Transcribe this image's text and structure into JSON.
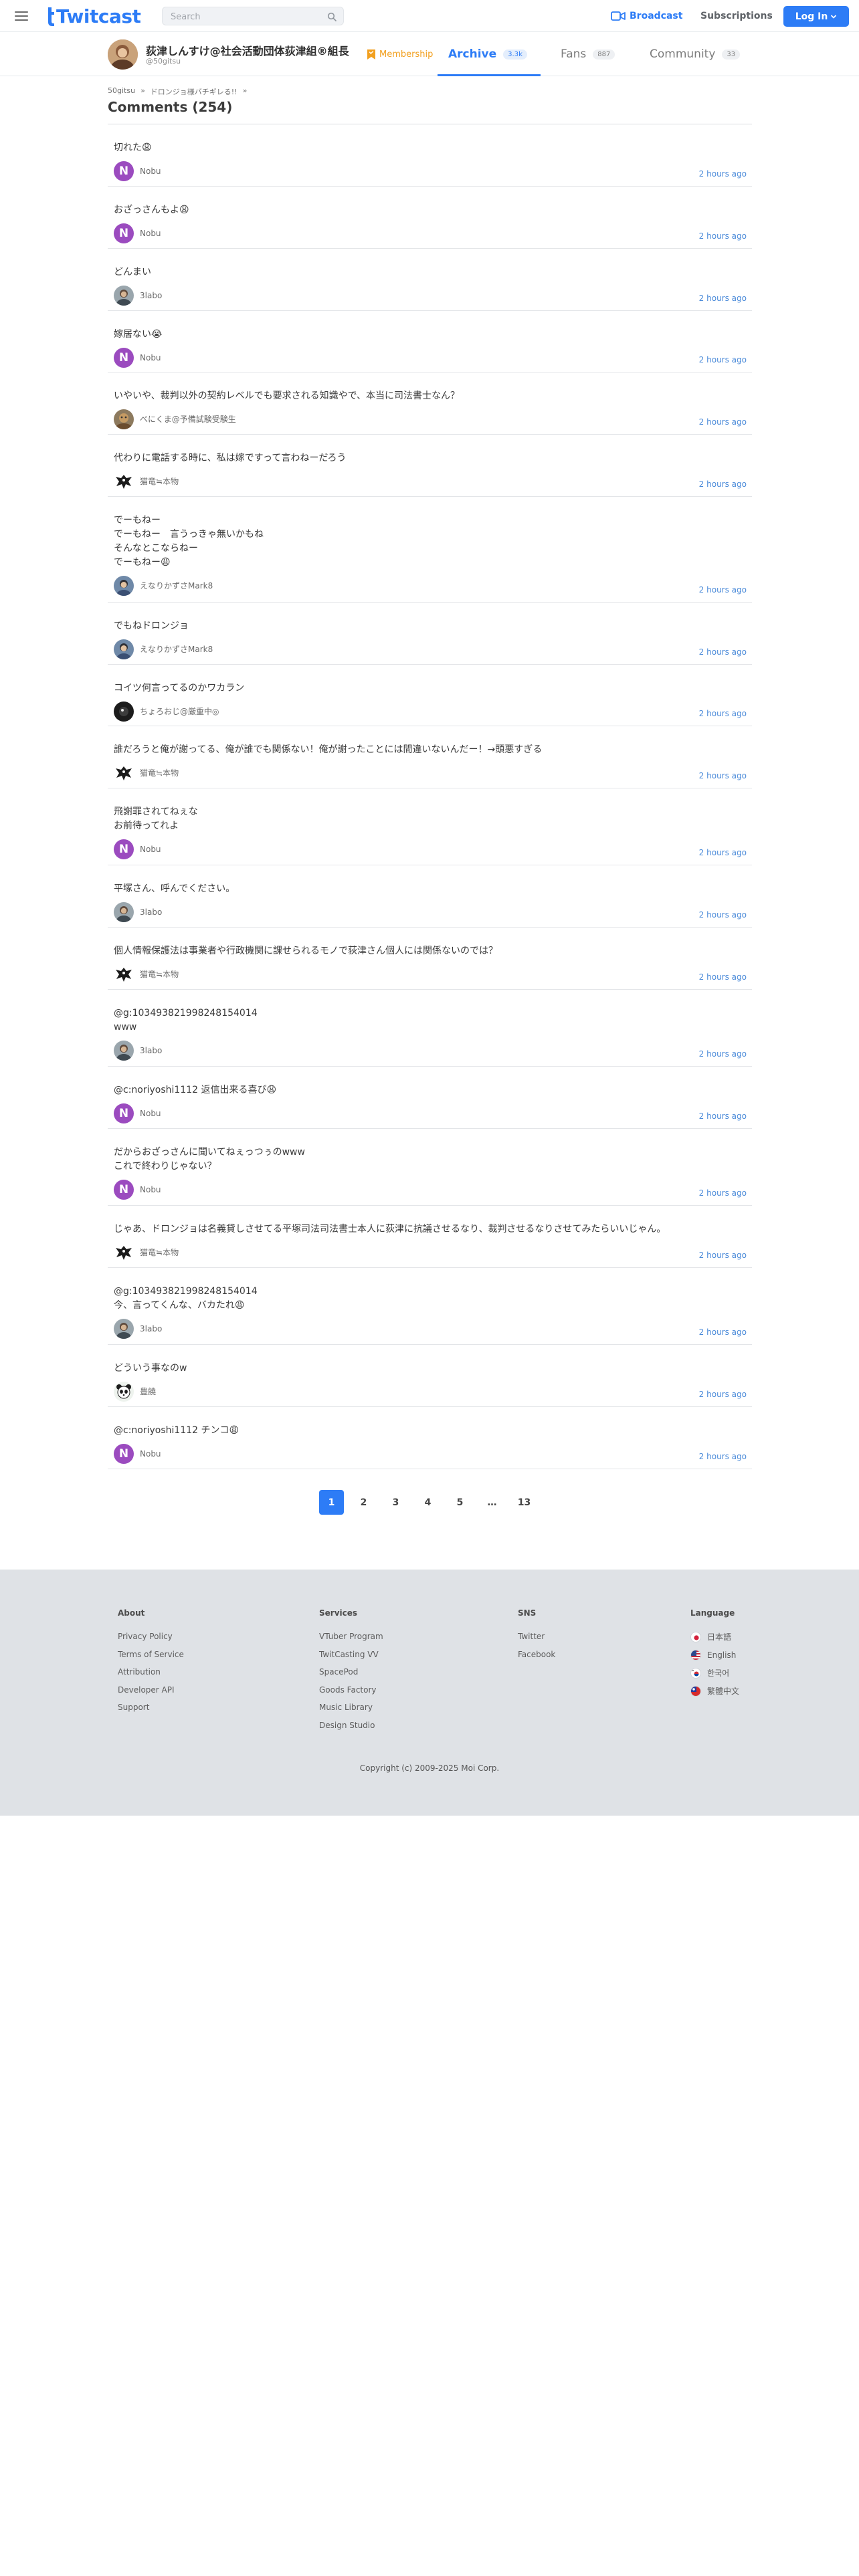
{
  "header": {
    "logo_text": "Twitcast",
    "search_placeholder": "Search",
    "broadcast_label": "Broadcast",
    "subscriptions_label": "Subscriptions",
    "login_label": "Log In"
  },
  "profile": {
    "name": "荻津しんすけ@社会活動団体荻津組®組長",
    "id": "@50gitsu",
    "membership_label": "Membership",
    "tabs": [
      {
        "label": "Archive",
        "count": "3.3k"
      },
      {
        "label": "Fans",
        "count": "887"
      },
      {
        "label": "Community",
        "count": "33"
      }
    ]
  },
  "breadcrumb": [
    "50gitsu",
    "»",
    "ドロンジョ様バチギレる!!",
    "»"
  ],
  "page_title": "Comments (254)",
  "comments": [
    {
      "text": "切れた😩",
      "user": "Nobu",
      "time": "2 hours ago"
    },
    {
      "text": "おざっさんもよ😩",
      "user": "Nobu",
      "time": "2 hours ago"
    },
    {
      "text": "どんまい",
      "user": "3labo",
      "time": "2 hours ago"
    },
    {
      "text": "嫁居ない😭",
      "user": "Nobu",
      "time": "2 hours ago"
    },
    {
      "text": "いやいや、裁判以外の契約レベルでも要求される知識やで、本当に司法書士なん？",
      "user": "べにくま@予備試験受験生",
      "time": "2 hours ago"
    },
    {
      "text": "代わりに電話する時に、私は嫁ですって言わねーだろう",
      "user": "猫竜≒本物",
      "time": "2 hours ago"
    },
    {
      "text": "でーもねー\nでーもねー　言うっきゃ無いかもね\nそんなとこならねー\nでーもねー😩",
      "user": "えなりかずさMark8",
      "time": "2 hours ago"
    },
    {
      "text": "でもねドロンジョ",
      "user": "えなりかずさMark8",
      "time": "2 hours ago"
    },
    {
      "text": "コイツ何言ってるのかワカラン",
      "user": "ちょろおじ@厳重中◎",
      "time": "2 hours ago"
    },
    {
      "text": "誰だろうと俺が謝ってる、俺が誰でも関係ない！俺が謝ったことには間違いないんだー！→頭悪すぎる",
      "user": "猫竜≒本物",
      "time": "2 hours ago"
    },
    {
      "text": "飛謝罪されてねぇな\nお前待ってれよ",
      "user": "Nobu",
      "time": "2 hours ago"
    },
    {
      "text": "平塚さん、呼んでください。",
      "user": "3labo",
      "time": "2 hours ago"
    },
    {
      "text": "個人情報保護法は事業者や行政機関に課せられるモノで荻津さん個人には関係ないのでは？",
      "user": "猫竜≒本物",
      "time": "2 hours ago"
    },
    {
      "text": "@g:103493821998248154014\nwww",
      "user": "3labo",
      "time": "2 hours ago"
    },
    {
      "text": "@c:noriyoshi1112 返信出来る喜び😩",
      "user": "Nobu",
      "time": "2 hours ago"
    },
    {
      "text": "だからおざっさんに聞いてねぇっつぅのwww\nこれで終わりじゃない？",
      "user": "Nobu",
      "time": "2 hours ago"
    },
    {
      "text": "じゃあ、ドロンジョは名義貸しさせてる平塚司法司法書士本人に荻津に抗議させるなり、裁判させるなりさせてみたらいいじゃん。",
      "user": "猫竜≒本物",
      "time": "2 hours ago"
    },
    {
      "text": "@g:103493821998248154014\n今、言ってくんな、バカたれ😩",
      "user": "3labo",
      "time": "2 hours ago"
    },
    {
      "text": "どういう事なのw",
      "user": "豊饒",
      "time": "2 hours ago"
    },
    {
      "text": "@c:noriyoshi1112 チンコ😩",
      "user": "Nobu",
      "time": "2 hours ago"
    }
  ],
  "pagination": [
    "1",
    "2",
    "3",
    "4",
    "5",
    "…",
    "13"
  ],
  "footer": {
    "about": {
      "heading": "About",
      "links": [
        "Privacy Policy",
        "Terms of Service",
        "Attribution",
        "Developer API",
        "Support"
      ]
    },
    "services": {
      "heading": "Services",
      "links": [
        "VTuber Program",
        "TwitCasting VV",
        "SpacePod",
        "Goods Factory",
        "Music Library",
        "Design Studio"
      ]
    },
    "sns": {
      "heading": "SNS",
      "links": [
        "Twitter",
        "Facebook"
      ]
    },
    "language": {
      "heading": "Language",
      "links": [
        "日本語",
        "English",
        "한국어",
        "繁體中文"
      ]
    },
    "copyright": "Copyright (c) 2009-2025 Moi Corp."
  },
  "colors": {
    "accent": "#2d7cf6",
    "membership": "#f2a01f",
    "time_link": "#4a8ad9",
    "footer_bg": "#dfe2e6"
  }
}
